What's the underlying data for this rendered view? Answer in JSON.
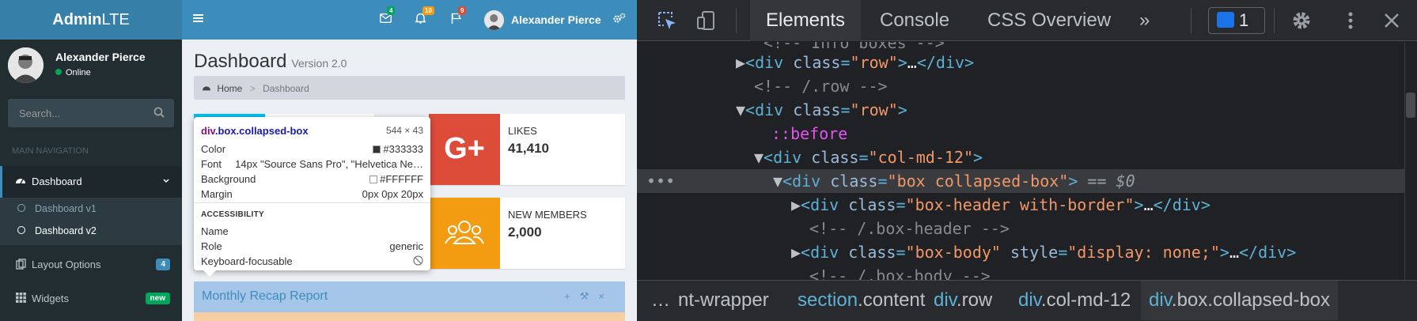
{
  "adminlte": {
    "logo_bold": "Admin",
    "logo_rest": "LTE",
    "user": {
      "name": "Alexander Pierce",
      "status": "Online"
    },
    "search_placeholder": "Search...",
    "nav_header": "MAIN NAVIGATION",
    "menu": [
      {
        "label": "Dashboard",
        "icon": "dashboard-icon"
      },
      {
        "label": "Dashboard v1"
      },
      {
        "label": "Dashboard v2"
      },
      {
        "label": "Layout Options",
        "badge": "4",
        "badge_color": "#3c8dbc"
      },
      {
        "label": "Widgets",
        "badge": "new",
        "badge_color": "#00a65a"
      }
    ],
    "topbar": {
      "messages_count": "4",
      "notifications_count": "10",
      "flags_count": "9",
      "user_name": "Alexander Pierce"
    },
    "page_title": "Dashboard",
    "page_version": "Version 2.0",
    "breadcrumb": {
      "home": "Home",
      "current": "Dashboard"
    },
    "info_boxes": [
      {
        "label": "LIKES",
        "value": "41,410",
        "icon": "google-plus-icon",
        "color": "#dd4b39",
        "icon_text": "G+"
      },
      {
        "label": "NEW MEMBERS",
        "value": "2,000",
        "icon": "users-icon",
        "color": "#f39c12"
      }
    ],
    "recap_title": "Monthly Recap Report",
    "tooltip": {
      "tag": "div",
      "classes": ".box.collapsed-box",
      "size": "544 × 43",
      "rows": [
        {
          "key": "Color",
          "value": "#333333"
        },
        {
          "key": "Font",
          "value": "14px \"Source Sans Pro\", \"Helvetica Ne…"
        },
        {
          "key": "Background",
          "value": "#FFFFFF"
        },
        {
          "key": "Margin",
          "value": "0px 0px 20px"
        }
      ],
      "accessibility_header": "ACCESSIBILITY",
      "acc_rows": [
        {
          "key": "Name",
          "value": ""
        },
        {
          "key": "Role",
          "value": "generic"
        },
        {
          "key": "Keyboard-focusable",
          "value": ""
        }
      ]
    }
  },
  "devtools": {
    "tabs": [
      "Elements",
      "Console",
      "CSS Overview"
    ],
    "more": "»",
    "issues_count": "1",
    "lines": [
      {
        "text": "<!-- Info boxes -->"
      },
      {
        "text": "<div class=\"row\">…</div>"
      },
      {
        "text": "<!-- /.row -->"
      },
      {
        "text": "<div class=\"row\">"
      },
      {
        "text": "::before"
      },
      {
        "text": "<div class=\"col-md-12\">"
      },
      {
        "text": "<div class=\"box collapsed-box\"> == $0"
      },
      {
        "text": "<div class=\"box-header with-border\">…</div>"
      },
      {
        "text": "<!-- /.box-header -->"
      },
      {
        "text": "<div class=\"box-body\" style=\"display: none;\">…</div>"
      },
      {
        "text": "<!-- /.box-body -->"
      }
    ],
    "breadcrumbs": [
      "…",
      "nt-wrapper",
      "section.content",
      "div.row",
      "div.col-md-12",
      "div.box.collapsed-box"
    ]
  }
}
